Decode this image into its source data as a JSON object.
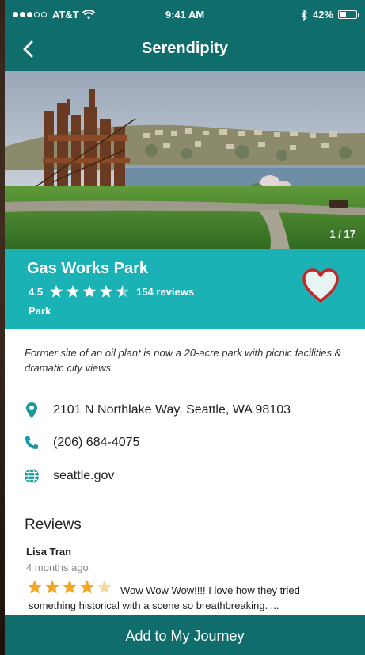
{
  "status_bar": {
    "carrier": "AT&T",
    "time": "9:41 AM",
    "battery": "42%",
    "battery_level": 0.42,
    "signal_bars": 3,
    "icons": [
      "wifi-icon",
      "bluetooth-icon",
      "battery-icon"
    ]
  },
  "nav": {
    "title": "Serendipity",
    "back_icon": "chevron-left-icon"
  },
  "hero": {
    "counter": "1 / 17"
  },
  "place": {
    "name": "Gas Works Park",
    "rating": "4.5",
    "rating_value": 4.5,
    "reviews_count": "154 reviews",
    "category": "Park",
    "favorite_icon": "heart-icon"
  },
  "description": "Former site of an oil plant is now a 20-acre park with picnic facilities & dramatic city views",
  "details": {
    "address": "2101 N Northlake Way, Seattle, WA 98103",
    "phone": "(206) 684-4075",
    "website": "seattle.gov"
  },
  "reviews": {
    "title": "Reviews",
    "items": [
      {
        "author": "Lisa Tran",
        "date": "4 months ago",
        "rating": 4,
        "text": "Wow Wow Wow!!!! I love how they tried something historical with a scene so breathbreaking. ..."
      }
    ]
  },
  "cta": {
    "label": "Add to My Journey"
  },
  "colors": {
    "primary_dark": "#0f6e6c",
    "accent_teal": "#1ab2b5",
    "star_orange": "#f5a623",
    "heart_red": "#c62828"
  }
}
